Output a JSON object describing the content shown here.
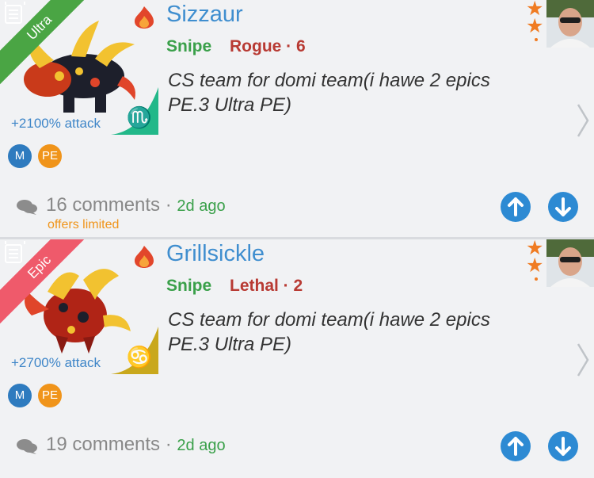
{
  "posts": [
    {
      "rarity": "Ultra",
      "attack": "+2100% attack",
      "zodiac_icon": "scorpio-icon",
      "zodiac_glyph": "♏",
      "name": "Sizzaur",
      "type": "Snipe",
      "class": "Rogue · 6",
      "description": "CS team for domi team(i hawe 2 epics PE.3 Ultra PE)",
      "badges": [
        "M",
        "PE"
      ],
      "comments": "16 comments",
      "ago": "2d ago",
      "offers": "offers limited"
    },
    {
      "rarity": "Epic",
      "attack": "+2700% attack",
      "zodiac_icon": "cancer-icon",
      "zodiac_glyph": "♋",
      "name": "Grillsickle",
      "type": "Snipe",
      "class": "Lethal · 2",
      "description": "CS team for domi team(i hawe 2 epics PE.3 Ultra PE)",
      "badges": [
        "M",
        "PE"
      ],
      "comments": "19 comments",
      "ago": "2d ago"
    }
  ],
  "separator": "·",
  "colors": {
    "name_blue": "#3f8ecf",
    "type_green": "#3aa04a",
    "class_red": "#b83a33",
    "ultra_green": "#4aa544",
    "epic_red": "#ef5a6b",
    "vote_blue": "#2d8ad3",
    "offers_orange": "#f0941a"
  }
}
